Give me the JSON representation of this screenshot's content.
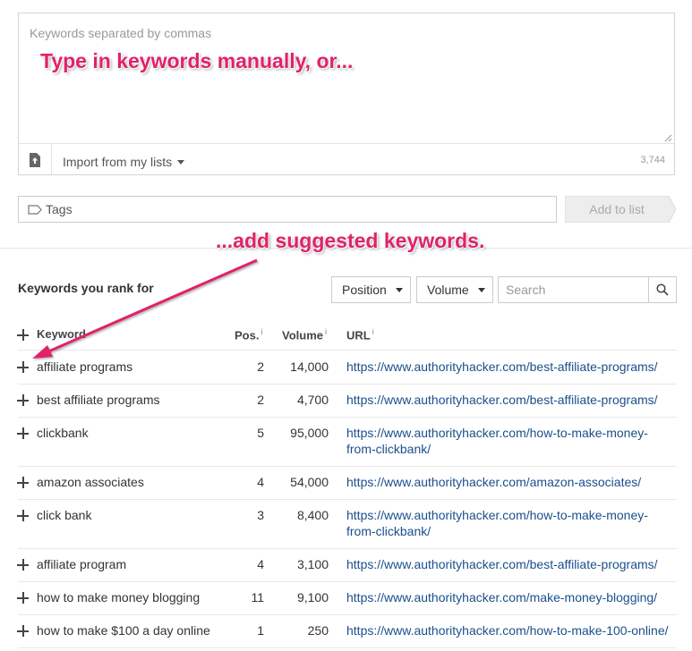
{
  "keywords_input": {
    "placeholder": "Keywords separated by commas",
    "value": "",
    "import_label": "Import from my lists",
    "char_count": "3,744"
  },
  "tags": {
    "placeholder": "Tags",
    "add_button_label": "Add to list"
  },
  "annotations": {
    "top": "Type in keywords manually, or...",
    "middle": "...add suggested keywords."
  },
  "rank_section": {
    "title": "Keywords you rank for",
    "position_filter": "Position",
    "volume_filter": "Volume",
    "search_placeholder": "Search",
    "columns": {
      "keyword": "Keyword",
      "pos": "Pos.",
      "volume": "Volume",
      "url": "URL",
      "info_marker": "i"
    },
    "rows": [
      {
        "keyword": "affiliate programs",
        "pos": "2",
        "volume": "14,000",
        "url_lines": [
          "https://www.authorityhacker.com/best-affiliate-programs/"
        ]
      },
      {
        "keyword": "best affiliate programs",
        "pos": "2",
        "volume": "4,700",
        "url_lines": [
          "https://www.authorityhacker.com/best-affiliate-programs/"
        ]
      },
      {
        "keyword": "clickbank",
        "pos": "5",
        "volume": "95,000",
        "url_lines": [
          "https://www.authorityhacker.com/how-to-make-money-",
          "from-clickbank/"
        ]
      },
      {
        "keyword": "amazon associates",
        "pos": "4",
        "volume": "54,000",
        "url_lines": [
          "https://www.authorityhacker.com/amazon-associates/"
        ]
      },
      {
        "keyword": "click bank",
        "pos": "3",
        "volume": "8,400",
        "url_lines": [
          "https://www.authorityhacker.com/how-to-make-money-",
          "from-clickbank/"
        ]
      },
      {
        "keyword": "affiliate program",
        "pos": "4",
        "volume": "3,100",
        "url_lines": [
          "https://www.authorityhacker.com/best-affiliate-programs/"
        ]
      },
      {
        "keyword": "how to make money blogging",
        "pos": "11",
        "volume": "9,100",
        "url_lines": [
          "https://www.authorityhacker.com/make-money-blogging/"
        ]
      },
      {
        "keyword": "how to make $100 a day online",
        "pos": "1",
        "volume": "250",
        "url_lines": [
          "https://www.authorityhacker.com/how-to-make-100-online/"
        ]
      }
    ]
  },
  "colors": {
    "annotation": "#e0226a",
    "link": "#1a4f8b"
  },
  "icons": {
    "import": "file-upload-icon",
    "tag": "tag-icon",
    "search": "magnifier-icon",
    "add_row": "plus-icon"
  }
}
